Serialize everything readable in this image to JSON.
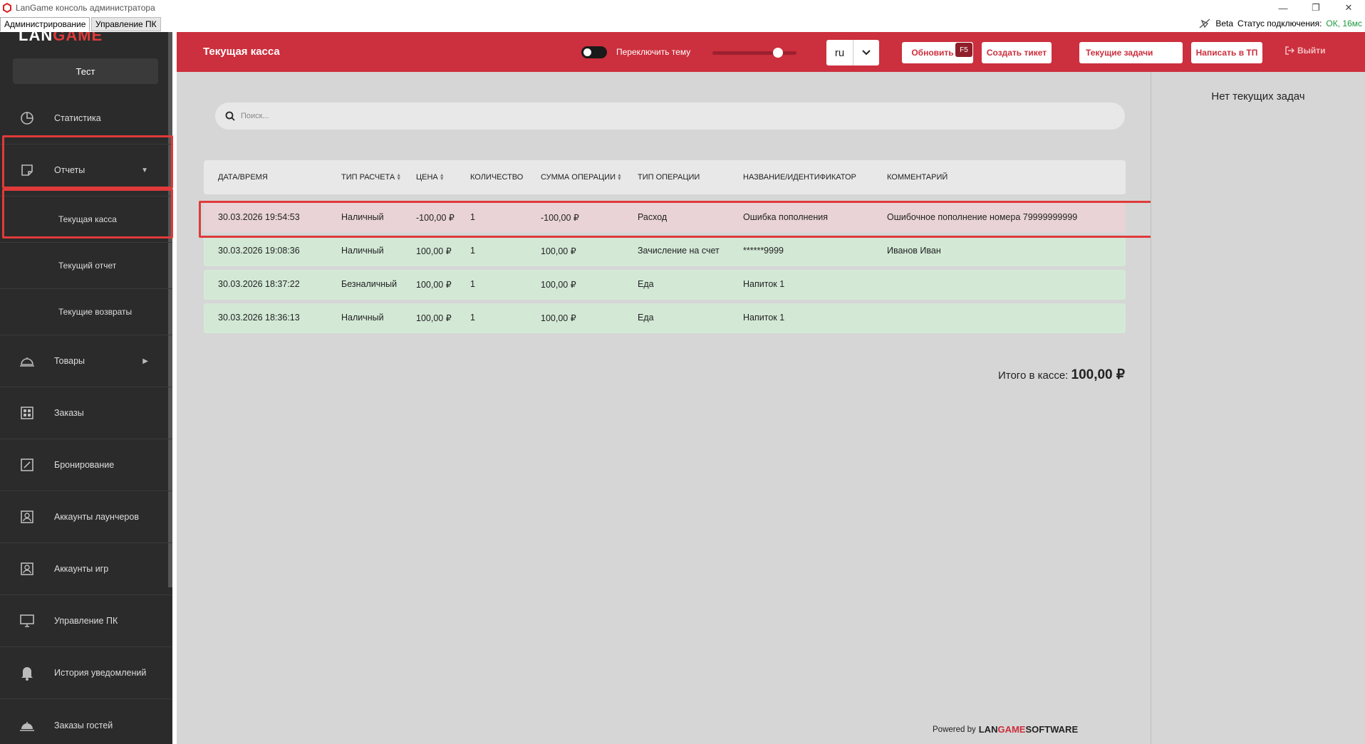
{
  "window": {
    "title": "LanGame консоль администратора",
    "tabs": [
      "Администрирование",
      "Управление ПК"
    ],
    "beta_label": "Beta",
    "status_label": "Статус подключения:",
    "status_value": "ОК, 16мс",
    "controls": [
      "—",
      "❐",
      "✕"
    ]
  },
  "sidebar": {
    "logo_left": "LAN",
    "logo_right": "GAME",
    "user": "Тест",
    "items": [
      {
        "label": "Статистика",
        "icon": "pie-chart-icon"
      },
      {
        "label": "Отчеты",
        "icon": "note-icon",
        "arrow": "▼"
      },
      {
        "label": "Товары",
        "icon": "cloche-icon",
        "arrow": "▶"
      },
      {
        "label": "Заказы",
        "icon": "grid-icon"
      },
      {
        "label": "Бронирование",
        "icon": "edit-icon"
      },
      {
        "label": "Аккаунты лаунчеров",
        "icon": "account-icon"
      },
      {
        "label": "Аккаунты игр",
        "icon": "account-icon"
      },
      {
        "label": "Управление ПК",
        "icon": "monitor-icon"
      },
      {
        "label": "История уведомлений",
        "icon": "bell-icon"
      },
      {
        "label": "Заказы гостей",
        "icon": "cloche-icon"
      }
    ],
    "sub_items": [
      "Текущая касса",
      "Текущий отчет",
      "Текущие возвраты"
    ]
  },
  "header": {
    "title": "Текущая касса",
    "theme_toggle_label": "Переключить тему",
    "slider_level": 0.78,
    "lang": "ru",
    "refresh": "Обновить",
    "refresh_key": "F5",
    "create_ticket": "Создать тикет",
    "current_tasks": "Текущие задачи",
    "write_support": "Написать в ТП",
    "logout": "Выйти"
  },
  "search": {
    "placeholder": "Поиск..."
  },
  "table": {
    "columns": [
      "ДАТА/ВРЕМЯ",
      "ТИП РАСЧЕТА",
      "ЦЕНА",
      "КОЛИЧЕСТВО",
      "СУММА ОПЕРАЦИИ",
      "ТИП ОПЕРАЦИИ",
      "НАЗВАНИЕ/ИДЕНТИФИКАТОР",
      "КОММЕНТАРИЙ"
    ],
    "rows": [
      [
        "30.03.2026 19:54:53",
        "Наличный",
        "-100,00 ₽",
        "1",
        "-100,00 ₽",
        "Расход",
        "Ошибка пополнения",
        "Ошибочное пополнение номера 79999999999"
      ],
      [
        "30.03.2026 19:08:36",
        "Наличный",
        "100,00 ₽",
        "1",
        "100,00 ₽",
        "Зачисление на счет",
        "******9999",
        "Иванов Иван"
      ],
      [
        "30.03.2026 18:37:22",
        "Безналичный",
        "100,00 ₽",
        "1",
        "100,00 ₽",
        "Еда",
        "Напиток 1",
        ""
      ],
      [
        "30.03.2026 18:36:13",
        "Наличный",
        "100,00 ₽",
        "1",
        "100,00 ₽",
        "Еда",
        "Напиток 1",
        ""
      ]
    ]
  },
  "total": {
    "label": "Итого в кассе:",
    "value": "100,00 ₽"
  },
  "right_panel": {
    "message": "Нет текущих задач"
  },
  "footer": {
    "powered_by": "Powered by",
    "brand_a": "LAN",
    "brand_b": "GAME",
    "brand_c": "SOFTWARE"
  },
  "colors": {
    "accent": "#cc2f3d",
    "sidebar": "#2b2b2b",
    "row_expense": "#e9d3d6",
    "row_income": "#d3e9d6"
  }
}
